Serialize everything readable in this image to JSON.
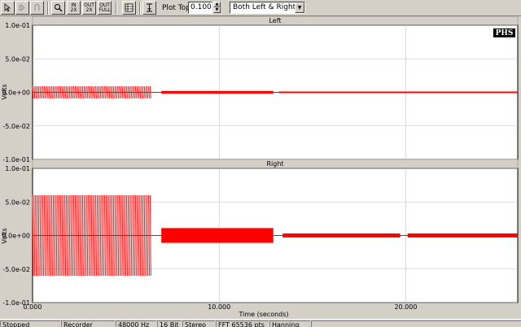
{
  "toolbar": {
    "buttons": [
      {
        "name": "pointer-icon"
      },
      {
        "name": "record-icon"
      },
      {
        "name": "marker-icon"
      },
      {
        "name": "zoom-icon"
      },
      {
        "name": "zoom-in-2x",
        "label": "IN 2X"
      },
      {
        "name": "zoom-out-2x",
        "label": "OUT 2X"
      },
      {
        "name": "zoom-out-full",
        "label": "OUT FULL"
      },
      {
        "name": "table-icon"
      },
      {
        "name": "cursor-icon"
      }
    ],
    "plot_top_label": "Plot Top:",
    "plot_top_value": "0.100",
    "channel_select": "Both Left & Right"
  },
  "logo": "PHS",
  "chart_data": [
    {
      "type": "line",
      "title": "Left",
      "ylabel": "Volts",
      "ylim": [
        -0.1,
        0.1
      ],
      "xlim": [
        0,
        26
      ],
      "y_ticks": [
        "1.0e-01",
        "5.0e-02",
        "0.0e+00",
        "-5.0e-02",
        "-1.0e-01"
      ],
      "color": "#ff0000",
      "segments": [
        {
          "x0": 0.0,
          "x1": 6.3,
          "amp": 0.009
        },
        {
          "x0": 6.9,
          "x1": 12.9,
          "amp": 0.002
        },
        {
          "x0": 13.2,
          "x1": 26.0,
          "amp": 0.0012
        }
      ]
    },
    {
      "type": "line",
      "title": "Right",
      "ylabel": "Volts",
      "ylim": [
        -0.1,
        0.1
      ],
      "xlim": [
        0,
        26
      ],
      "y_ticks": [
        "1.0e-01",
        "5.0e-02",
        "0.0e+00",
        "-5.0e-02",
        "-1.0e-01"
      ],
      "x_ticks": [
        "0.000",
        "10.000",
        "20.000"
      ],
      "xlabel": "Time (seconds)",
      "color": "#ff0000",
      "segments": [
        {
          "x0": 0.0,
          "x1": 6.3,
          "amp": 0.06
        },
        {
          "x0": 6.9,
          "x1": 12.9,
          "amp": 0.011
        },
        {
          "x0": 13.4,
          "x1": 19.7,
          "amp": 0.003
        },
        {
          "x0": 20.1,
          "x1": 26.0,
          "amp": 0.003
        }
      ]
    }
  ],
  "status": {
    "state": "Stopped",
    "mode": "Recorder",
    "rate": "48000 Hz",
    "bits": "16 Bit",
    "channels": "Stereo",
    "fft": "FFT 65536 pts",
    "window": "Hanning"
  }
}
